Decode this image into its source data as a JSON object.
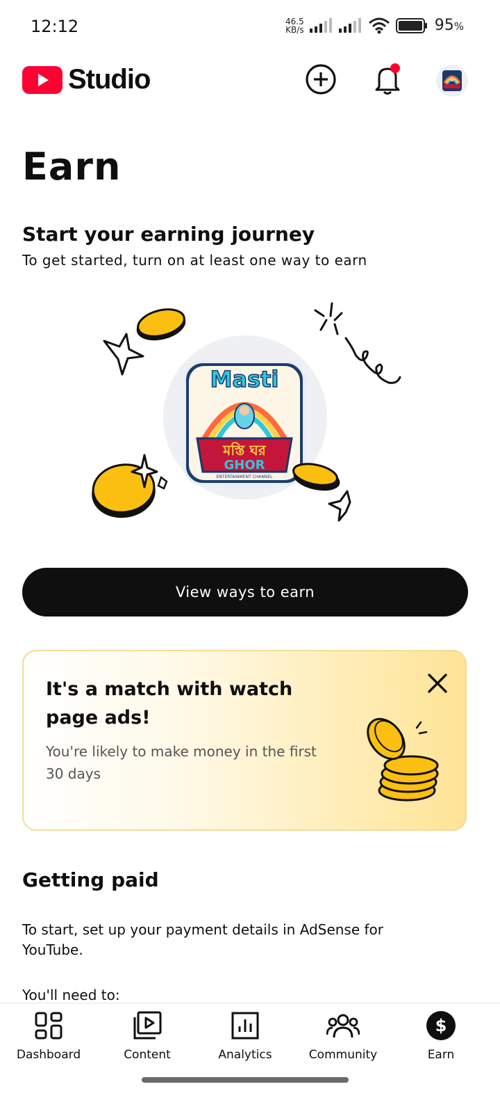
{
  "status_bar": {
    "time": "12:12",
    "net_speed_value": "46.5",
    "net_speed_unit": "KB/s",
    "battery": "95",
    "battery_unit": "%"
  },
  "app_bar": {
    "logo_text": "Studio",
    "icons": [
      "create-icon",
      "notifications-icon",
      "channel-avatar"
    ],
    "notification_dot_color": "#ff0033",
    "brand_color": "#ff0033"
  },
  "page": {
    "title": "Earn"
  },
  "earning": {
    "title": "Start your earning journey",
    "subtitle": "To get started, turn on at least one way to earn",
    "cta_label": "View ways to earn"
  },
  "promo": {
    "title": "It's a match with watch page ads!",
    "text": "You're likely to make money in the first 30 days"
  },
  "getting_paid": {
    "title": "Getting paid",
    "text": "To start, set up your payment details in AdSense for YouTube.",
    "need": "You'll need to:"
  },
  "bottom_nav": {
    "items": [
      {
        "label": "Dashboard",
        "icon": "dashboard-icon"
      },
      {
        "label": "Content",
        "icon": "content-icon"
      },
      {
        "label": "Analytics",
        "icon": "analytics-icon"
      },
      {
        "label": "Community",
        "icon": "community-icon"
      },
      {
        "label": "Earn",
        "icon": "earn-icon",
        "selected": true
      }
    ]
  }
}
